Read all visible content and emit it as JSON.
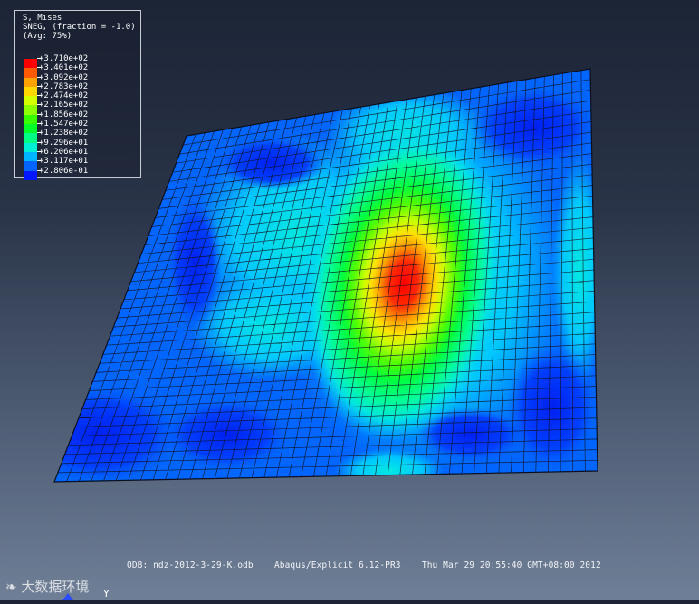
{
  "legend": {
    "title": "S, Mises",
    "subtitle": "SNEG, (fraction = -1.0)",
    "averaging": "(Avg: 75%)",
    "levels": [
      {
        "label": "+3.710e+02",
        "color": "#ff0000"
      },
      {
        "label": "+3.401e+02",
        "color": "#ff5a00"
      },
      {
        "label": "+3.092e+02",
        "color": "#ffa200"
      },
      {
        "label": "+2.783e+02",
        "color": "#ffd800"
      },
      {
        "label": "+2.474e+02",
        "color": "#d4ff00"
      },
      {
        "label": "+2.165e+02",
        "color": "#8cff00"
      },
      {
        "label": "+1.856e+02",
        "color": "#36ff00"
      },
      {
        "label": "+1.547e+02",
        "color": "#00ff2a"
      },
      {
        "label": "+1.238e+02",
        "color": "#00ff85"
      },
      {
        "label": "+9.296e+01",
        "color": "#00f0d6"
      },
      {
        "label": "+6.206e+01",
        "color": "#00b4ff"
      },
      {
        "label": "+3.117e+01",
        "color": "#0064ff"
      },
      {
        "label": "+2.806e-01",
        "color": "#0018ff"
      }
    ]
  },
  "status": {
    "odb": "ODB: ndz-2012-3-29-K.odb",
    "solver": "Abaqus/Explicit 6.12-PR3",
    "timestamp": "Thu Mar 29 20:55:40 GMT+08:00 2012"
  },
  "triad": {
    "axis_label": "Y"
  },
  "watermark": {
    "text": "大数据环境"
  },
  "colors": {
    "mesh_line": "#0a1020",
    "peak": "#ff0000",
    "low": "#0018ff"
  }
}
